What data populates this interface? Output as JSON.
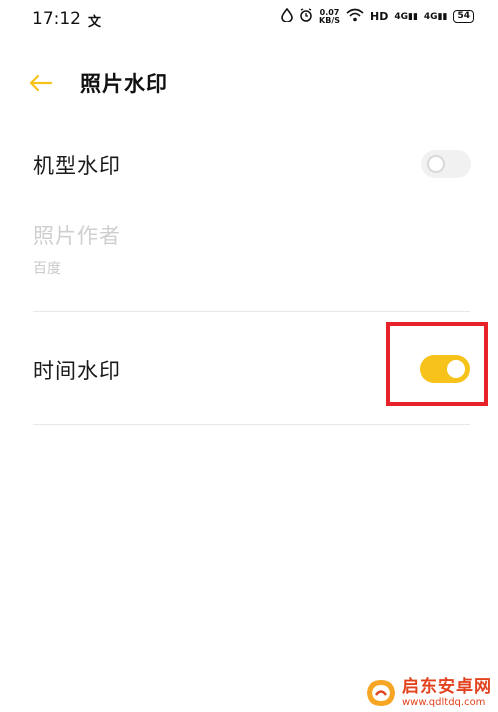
{
  "status_bar": {
    "time": "17:12",
    "app_icon_text": "文",
    "net_speed_top": "0.07",
    "net_speed_bottom": "KB/S",
    "hd_label": "HD",
    "signal1": "4G",
    "signal2": "4G",
    "battery": "54"
  },
  "header": {
    "title": "照片水印",
    "accent_color": "#f7c21a"
  },
  "settings": [
    {
      "label": "机型水印",
      "toggle_state": "off",
      "enabled": true
    },
    {
      "label": "照片作者",
      "sub_value": "百度",
      "enabled": false
    },
    {
      "label": "时间水印",
      "toggle_state": "on",
      "enabled": true
    }
  ],
  "watermark": {
    "name": "启东安卓网",
    "url": "www.qdltdq.com"
  }
}
